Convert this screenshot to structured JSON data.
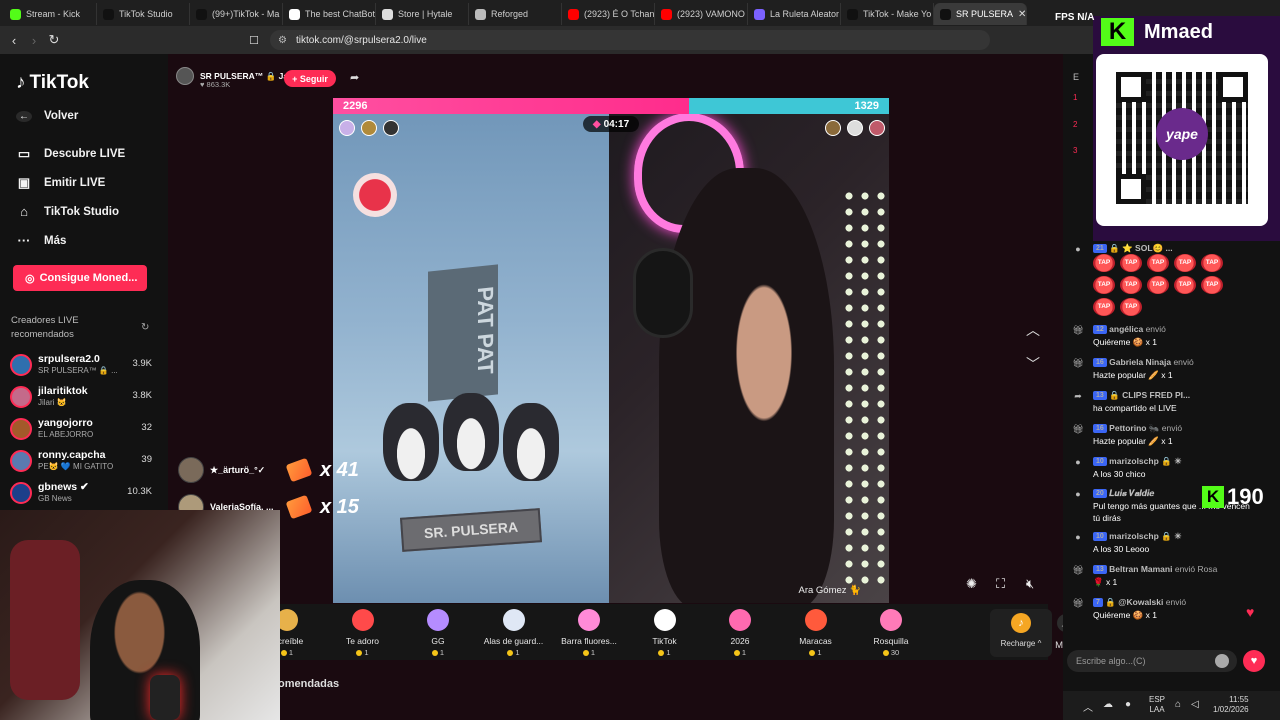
{
  "browser": {
    "tabs": [
      {
        "label": "Stream - Kick",
        "color": "#53fc18"
      },
      {
        "label": "TikTok Studio",
        "color": "#111111"
      },
      {
        "label": "(99+)TikTok - Ma",
        "color": "#111111"
      },
      {
        "label": "The best ChatBot",
        "color": "#ffffff"
      },
      {
        "label": "Store | Hytale",
        "color": "#dddddd"
      },
      {
        "label": "Reforged",
        "color": "#bbbbbb"
      },
      {
        "label": "(2923) É O Tchan",
        "color": "#ff0000"
      },
      {
        "label": "(2923) VAMONO",
        "color": "#ff0000"
      },
      {
        "label": "La Ruleta Aleator",
        "color": "#7b61ff"
      },
      {
        "label": "TikTok - Make Yo",
        "color": "#111111"
      },
      {
        "label": "SR PULSERA",
        "color": "#111111",
        "active": true
      }
    ],
    "url": "tiktok.com/@srpulsera2.0/live"
  },
  "sidebar": {
    "logo": "TikTok",
    "nav": [
      {
        "label": "Volver",
        "icon": "back-arrow-icon"
      },
      {
        "label": "Descubre LIVE",
        "icon": "live-tv-icon"
      },
      {
        "label": "Emitir LIVE",
        "icon": "camera-icon"
      },
      {
        "label": "TikTok Studio",
        "icon": "home-icon"
      },
      {
        "label": "Más",
        "icon": "more-dots-icon"
      }
    ],
    "coins_button": "Consigue Moned...",
    "reco_title": "Creadores LIVE recomendados",
    "creators": [
      {
        "name": "srpulsera2.0",
        "sub": "SR PULSERA™ 🔒 ...",
        "count": "3.9K",
        "color": "#2f6fae"
      },
      {
        "name": "jilaritiktok",
        "sub": "Jilari 😺",
        "count": "3.8K",
        "color": "#c46a8a"
      },
      {
        "name": "yangojorro",
        "sub": "EL ABEJORRO",
        "count": "32",
        "color": "#a35a2a"
      },
      {
        "name": "ronny.capcha",
        "sub": "PE😺 💙 MI GATITO",
        "count": "39",
        "color": "#5a7ab0"
      },
      {
        "name": "gbnews ✔",
        "sub": "GB News",
        "count": "10.3K",
        "color": "#1d3f8a"
      }
    ]
  },
  "stream": {
    "host": "SR PULSERA™ 🔒 Ja",
    "likes": "♥ 863.3K",
    "follow_label": "+ Seguir",
    "score_left": "2296",
    "score_right": "1329",
    "timer": "04:17",
    "sign_text": "PAT PAT",
    "plate_text": "SR. PULSERA",
    "opponent": "Ara Gómez 🐈",
    "comments": [
      {
        "name": "★_ärturö_°✓",
        "mult": "x 41"
      },
      {
        "name": "ValeriaSofía. ...",
        "mult": "x 15"
      }
    ],
    "gifts": [
      {
        "name": "Increíble",
        "price": "1",
        "color": "#e7b14a"
      },
      {
        "name": "Te adoro",
        "price": "1",
        "color": "#ff4a4a"
      },
      {
        "name": "GG",
        "price": "1",
        "color": "#b58cff"
      },
      {
        "name": "Alas de guard...",
        "price": "1",
        "color": "#dfe7f5"
      },
      {
        "name": "Barra fluores...",
        "price": "1",
        "color": "#ff8ad8"
      },
      {
        "name": "TikTok",
        "price": "1",
        "color": "#ffffff"
      },
      {
        "name": "2026",
        "price": "1",
        "color": "#ff6ab0"
      },
      {
        "name": "Maracas",
        "price": "1",
        "color": "#ff5a3c"
      },
      {
        "name": "Rosquilla",
        "price": "30",
        "color": "#ff7ab8"
      }
    ],
    "more_label": "More",
    "recharge_label": "Recharge ^",
    "recos_heading": "omendadas"
  },
  "chat": {
    "header": "E",
    "ranks": [
      "1",
      "2",
      "3"
    ],
    "messages": [
      {
        "icon": "user-icon",
        "level": "21",
        "user": "🔒 ⭐ SOL😊 ...",
        "action": "",
        "text": ""
      },
      {
        "icon": "gift-icon",
        "level": "12",
        "user": "angélica",
        "action": "envió",
        "text": "Quiéreme 🍪 x 1"
      },
      {
        "icon": "gift-icon",
        "level": "16",
        "user": "Gabriela Ninaja",
        "action": "envió",
        "text": "Hazte popular 🥖 x 1"
      },
      {
        "icon": "share-icon",
        "level": "13",
        "user": "🔒 CLIPS FRED PI...",
        "action": "",
        "text": "ha compartido el LIVE"
      },
      {
        "icon": "gift-icon",
        "level": "16",
        "user": "Pettorino 🐜",
        "action": "envió",
        "text": "Hazte popular 🥖 x 1"
      },
      {
        "icon": "user-icon",
        "level": "10",
        "user": "marizolschp 🔒 ☀",
        "action": "",
        "text": "A los 30 chico"
      },
      {
        "icon": "user-icon",
        "level": "20",
        "user": "𝑳𝒖𝒊𝒔 𝑽𝒂𝒍𝒅𝒊𝒆",
        "action": "",
        "text": "Pul tengo más guantes que ... me vencen tú dirás"
      },
      {
        "icon": "user-icon",
        "level": "10",
        "user": "marizolschp 🔒 ☀",
        "action": "",
        "text": "A los 30 Leooo"
      },
      {
        "icon": "gift-icon",
        "level": "13",
        "user": "Beltran Mamani",
        "action": "envió Rosa",
        "text": "🌹 x 1"
      },
      {
        "icon": "gift-icon",
        "level": "7",
        "user": "🔒 @Kowalski",
        "action": "envió",
        "text": "Quiéreme 🍪 x 1"
      }
    ],
    "tap_label": "TAP",
    "input_placeholder": "Escribe algo...(C)"
  },
  "overlay": {
    "kick_user": "Mmaed",
    "kick_count": "190",
    "yape_label": "yape",
    "fps_label": "FPS N/A"
  },
  "taskbar": {
    "lang1": "ESP",
    "lang2": "LAA",
    "time": "11:55",
    "date": "1/02/2026"
  }
}
